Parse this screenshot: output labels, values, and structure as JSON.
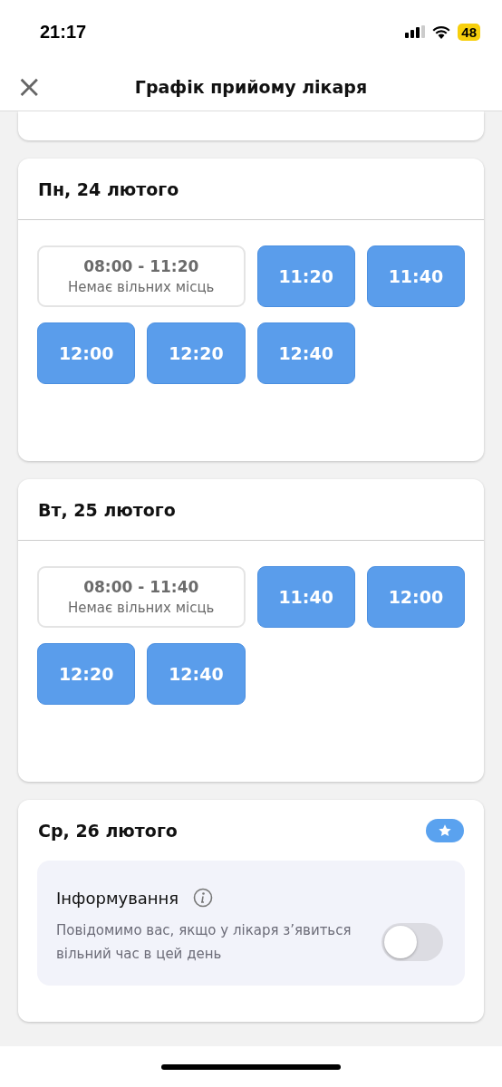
{
  "status_bar": {
    "time": "21:17",
    "battery": "48"
  },
  "header": {
    "title": "Графік прийому лікаря",
    "close_icon": "×"
  },
  "days": [
    {
      "title": "Пн, 24 лютого",
      "starred": false,
      "busy": {
        "range": "08:00 - 11:20",
        "note": "Немає вільних місць"
      },
      "slots": [
        "11:20",
        "11:40",
        "12:00",
        "12:20",
        "12:40"
      ]
    },
    {
      "title": "Вт, 25 лютого",
      "starred": false,
      "busy": {
        "range": "08:00 - 11:40",
        "note": "Немає вільних місць"
      },
      "slots": [
        "11:40",
        "12:00",
        "12:20",
        "12:40"
      ]
    },
    {
      "title": "Ср, 26 лютого",
      "starred": true,
      "notify": {
        "title": "Інформування",
        "text": "Повідомимо вас, якщо у лікаря з’явиться вільний час в цей день",
        "on": false
      }
    }
  ]
}
